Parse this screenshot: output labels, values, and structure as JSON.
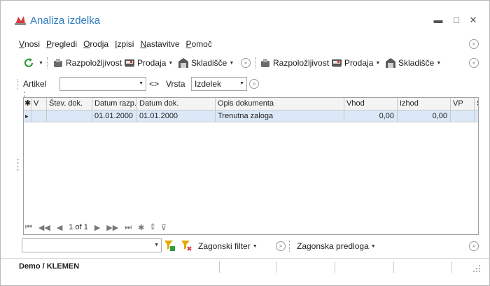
{
  "window": {
    "title": "Analiza izdelka",
    "minimize": "▬",
    "maximize": "□",
    "close": "✕"
  },
  "menu": [
    {
      "underline": "V",
      "rest": "nosi"
    },
    {
      "underline": "P",
      "rest": "regledi"
    },
    {
      "underline": "O",
      "rest": "rodja"
    },
    {
      "underline": "I",
      "rest": "zpisi"
    },
    {
      "underline": "N",
      "rest": "astavitve"
    },
    {
      "underline": "P",
      "rest": "omoč"
    }
  ],
  "toolbar": {
    "availability": "Razpoložljivost",
    "sales": "Prodaja",
    "warehouse": "Skladišče",
    "availability2": "Razpoložljivost",
    "sales2": "Prodaja",
    "warehouse2": "Skladišče"
  },
  "filter": {
    "article_label": "Artikel :",
    "article_value": "",
    "compare": "<>",
    "type_label": "Vrsta",
    "type_value": "Izdelek"
  },
  "grid": {
    "columns": [
      "✱",
      "V",
      "Štev. dok.",
      "Datum razp.",
      "Datum dok.",
      "Opis dokumenta",
      "Vhod",
      "Izhod",
      "VP",
      "S"
    ],
    "rows": [
      {
        "marker": "▸",
        "v": "",
        "doc_no": "",
        "date_avail": "01.01.2000",
        "date_doc": "01.01.2000",
        "description": "Trenutna zaloga",
        "in": "0,00",
        "out": "0,00",
        "vp": ""
      }
    ]
  },
  "navigator": {
    "page": "1 of 1"
  },
  "bottom": {
    "filter_value": "",
    "template_filter": "Zagonski filter",
    "template_layout": "Zagonska predloga"
  },
  "status": {
    "user": "Demo / KLEMEN"
  },
  "colors": {
    "title": "#2b7bbd",
    "selected_row": "#dbe8f7",
    "refresh_green": "#2e9e3a"
  }
}
